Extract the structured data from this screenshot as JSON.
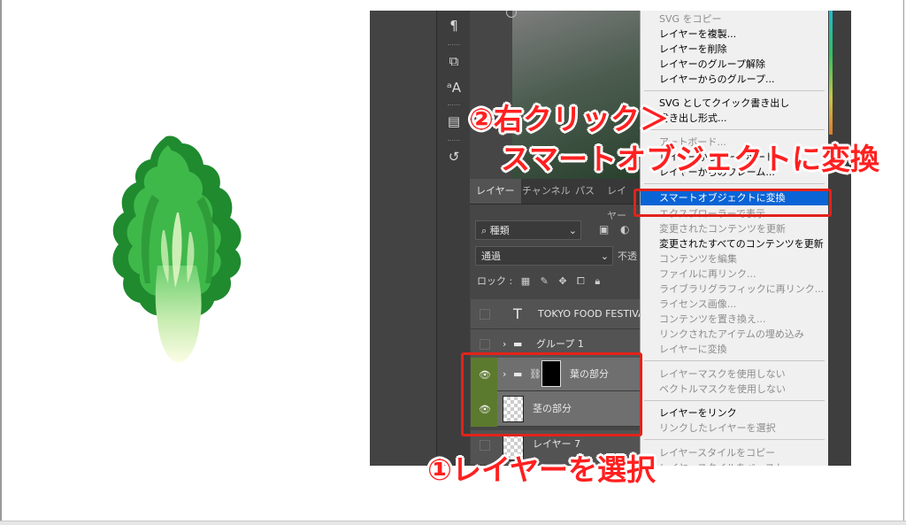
{
  "layers_panel": {
    "tabs": [
      "レイヤー",
      "チャンネル",
      "パス",
      "レイヤー"
    ],
    "filter_label": "種類",
    "blend_mode": "通過",
    "opacity_label": "不透",
    "lock_label": "ロック :",
    "layers": [
      {
        "name": "TOKYO FOOD FESTIVA",
        "kind": "text",
        "selected": false,
        "visible": false
      },
      {
        "name": "グループ 1",
        "kind": "group",
        "selected": false,
        "visible": false
      },
      {
        "name": "葉の部分",
        "kind": "group-masked",
        "selected": true,
        "visible": true
      },
      {
        "name": "茎の部分",
        "kind": "smart",
        "selected": true,
        "visible": true
      },
      {
        "name": "レイヤー 7",
        "kind": "pixel",
        "selected": false,
        "visible": false
      }
    ]
  },
  "context_menu": {
    "items": [
      {
        "label": "SVG をコピー",
        "enabled": false
      },
      {
        "label": "レイヤーを複製...",
        "enabled": true
      },
      {
        "label": "レイヤーを削除",
        "enabled": true
      },
      {
        "label": "レイヤーのグループ解除",
        "enabled": true
      },
      {
        "label": "レイヤーからのグループ...",
        "enabled": true
      },
      {
        "label": "SVG としてクイック書き出し",
        "enabled": true
      },
      {
        "label": "書き出し形式...",
        "enabled": true
      },
      {
        "label": "アートボード...",
        "enabled": false
      },
      {
        "label": "レイヤーからアートボード...",
        "enabled": true
      },
      {
        "label": "レイヤーからのフレーム...",
        "enabled": true
      },
      {
        "label": "スマートオブジェクトに変換",
        "enabled": true,
        "highlighted": true
      },
      {
        "label": "エクスプローラーで表示",
        "enabled": false
      },
      {
        "label": "変更されたコンテンツを更新",
        "enabled": false
      },
      {
        "label": "変更されたすべてのコンテンツを更新",
        "enabled": true
      },
      {
        "label": "コンテンツを編集",
        "enabled": false
      },
      {
        "label": "ファイルに再リンク...",
        "enabled": false
      },
      {
        "label": "ライブラリグラフィックに再リンク...",
        "enabled": false
      },
      {
        "label": "ライセンス画像...",
        "enabled": false
      },
      {
        "label": "コンテンツを置き換え...",
        "enabled": false
      },
      {
        "label": "リンクされたアイテムの埋め込み",
        "enabled": false
      },
      {
        "label": "レイヤーに変換",
        "enabled": false
      },
      {
        "label": "レイヤーマスクを使用しない",
        "enabled": false
      },
      {
        "label": "ベクトルマスクを使用しない",
        "enabled": false
      },
      {
        "label": "レイヤーをリンク",
        "enabled": true
      },
      {
        "label": "リンクしたレイヤーを選択",
        "enabled": false
      },
      {
        "label": "レイヤースタイルをコピー",
        "enabled": false
      },
      {
        "label": "レイヤースタイルをペースト",
        "enabled": false
      }
    ]
  },
  "annotations": {
    "step1": "①レイヤーを選択",
    "step2_line1": "②右クリック＞",
    "step2_line2": "スマートオブジェクトに変換"
  },
  "colors": {
    "highlight": "#0a64d6",
    "callout_text": "#ff2020",
    "callout_box": "#e2231a",
    "eye_active": "#5c7a2e"
  }
}
